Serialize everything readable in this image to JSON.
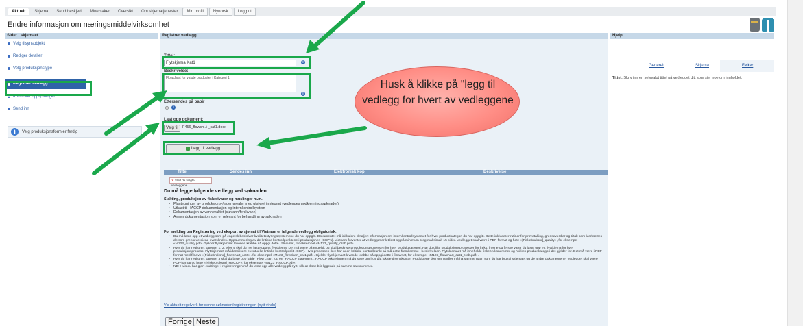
{
  "tabs": [
    {
      "label": "Aktuelt",
      "active": true
    },
    {
      "label": "Skjema"
    },
    {
      "label": "Send beskjed"
    },
    {
      "label": "Mine saker"
    },
    {
      "label": "Oversikt"
    },
    {
      "label": "Om skjematjenester"
    },
    {
      "label": "Min profil",
      "boxed": true
    },
    {
      "label": "Nynorsk",
      "boxed": true
    },
    {
      "label": "Logg ut",
      "boxed": true
    }
  ],
  "page_title": "Endre informasjon om næringsmiddelvirksomhet",
  "sidebar": {
    "header": "Sider i skjemaet",
    "items": [
      {
        "label": "Velg tilsynsobjekt"
      },
      {
        "label": "Rediger detaljer"
      },
      {
        "label": "Velg produksjonstype"
      },
      {
        "label": "Registrer vedlegg",
        "current": true
      },
      {
        "label": "Kontroller opplysninger"
      },
      {
        "label": "Send inn"
      }
    ],
    "info": "Velg produksjonsform er ferdig"
  },
  "form": {
    "header": "Registrer vedlegg",
    "title_label": "Tittel:",
    "title_value": "Flytskjema Kat1",
    "desc_label": "Beskrivelse:",
    "desc_value": "Flowchart for valgte produkter i Kategori 1",
    "paper_label": "Ettersendes på papir",
    "upload_label": "Last opp dokument:",
    "upload_button": "Velg fil",
    "upload_file": "F456_flowch..t _cat1.docx",
    "add_button": "Legg til vedlegg"
  },
  "table": {
    "columns": [
      "Tittel",
      "Sendes inn",
      "Elektronisk kopi",
      "Beskrivelse"
    ],
    "delete_button": "Slett de valgte vedleggene"
  },
  "requirements": {
    "heading": "Du må legge følgende vedlegg ved søknaden:",
    "sub1": "Slakting, produksjon av fiskerivarer og muslinger m.m.",
    "list1": [
      "Plantegninger av produksjons-/lager-arealer med utstyret inntegnet (vedlegges godkjenningssøknader)",
      "Utkast til HACCP dokumentasjon og internkontrollsystem",
      "Dokumentasjon av vannkvalitet (sjøvann/ferskvann)",
      "Annen dokumentasjon som er relevant for behandling av søknaden"
    ],
    "sub2": "For melding om Registrering ved eksport av sjømat til Vietnam er følgende vedlegg obligatorisk:",
    "list2": [
      "Du må laste opp et vedlegg som på engelsk beskriver kvalitetsstyringssystemene du har oppgitt. Dokumentet må inkludere detaljert informasjon om internkontrollsystemet for hver produktkategori du har oppgitt. Dette inkluderer rutiner for prøvetaking, grenseverdier og tiltak som iverksettes dersom grenseverdiene overskrides. Oppsummering av de kritiske kontrollpunktene i produksjonen (CCP's). Vietnam forventer at vedlegget er lettlest og på minimum 5 og maksimalt 15 sider. Vedlegget skal være i PDF-format og hete «[Fiskebruksnr]_quality», for eksempel «M123_quality.pdf» Gjelder flytskjemaet levende krabbe så oppgi dette i filnavnet, for eksempel «M123_quality_crab.pdf».",
      "Hvis du har registrert kategori 1, 2, eller 4 skal du her laste opp et flytskjema. Det må være på engelsk og skal beskrive produksjonsprosessen for hver produktkategori. Har du ulike produksjonsprosesser for f.eks. frosne og ferske varer du laste opp ett flytskjema for hver produksjonsprosess. Flytskjemaet må identifisere eventuelle kritiske kontrollpunkt (CCP). Hvis prosessen ikke har noen kritiske kontrollpunkt så må dette fremkomme i beskrivelsen. Flytskjemaet må inneholde fiskebruksnummer og hvilken produktkategori det gjelder for. Det må være i PDF-format med filnavn «[Fiskebruksnr]_flowchart_catX». for eksempel «M123_flowchart_cat1.pdf». Gjelder flytskjemaet levende krabbe så oppgi dette i filnavnet, for eksempel «M123_flowchart_cat1_crab.pdf».",
      "Hvis du har registrert kategori 3 skal du laste opp både \"Flow chart\" og en \"HACCP statement\". HACCP erklæringen må du søke om hos ditt lokale tilsynskontor. Produktene den omhandler må ha samme navn som du har brukt i skjemaet og de andre dokumentene. Vedlegget skal være i PDF-format og hete «[Fiskebruksnr]_HACCP», for eksempel «M123_HACCP.pdf».",
      "NB: Hvis du har gjort endringer i registreringen må du laste opp alle vedlegg på nytt, slik at disse blir liggende på samme saksnummer."
    ],
    "link": "Vis aktuelt regelverk for denne søknaden/registreringen (nytt vindu)"
  },
  "nav": {
    "prev": "Forrige",
    "next": "Neste"
  },
  "help": {
    "header": "Hjelp",
    "tabs": [
      {
        "label": "Generelt"
      },
      {
        "label": "Skjema"
      },
      {
        "label": "Felter",
        "active": true
      }
    ],
    "text_label": "Tittel:",
    "text": "Skriv inn en selvvalgt tittel på vedlegget ditt som sier noe om innholdet."
  },
  "callout": "Husk å klikke på \"legg til vedlegg for hvert av vedleggene",
  "colors": {
    "highlight": "#1aa84b",
    "header": "#c6d8e8",
    "selected": "#2f63a8",
    "callout": "#ff8d85"
  }
}
